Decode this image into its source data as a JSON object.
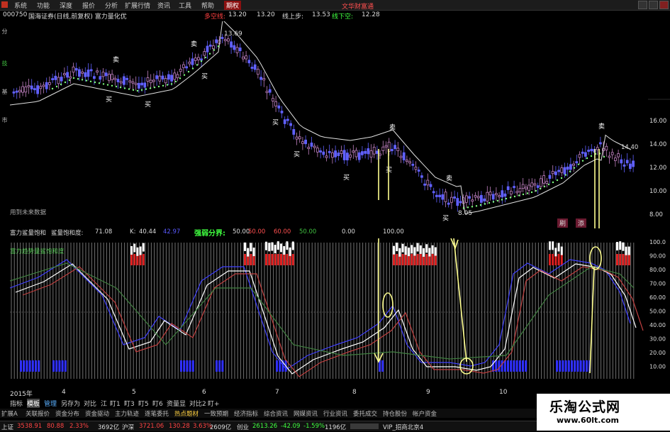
{
  "menu": {
    "items": [
      "系统",
      "功能",
      "深度",
      "报价",
      "分析",
      "扩展行情",
      "资讯",
      "工具",
      "帮助",
      "期权"
    ],
    "active_index": 9
  },
  "info_bar": {
    "code": "000750",
    "title": "国海证券(日线,前复权) 富力量化优",
    "duokong_label": "多空线:",
    "duokong_value": "13.20",
    "val2": "13.20",
    "xianshang_label": "线上步:",
    "xianshang_value": "13.53",
    "xianxia_label": "线下空:",
    "xianxia_value": "12.28",
    "top_right": "文华财富通"
  },
  "side_tabs": [
    "分时走势",
    "技术分析",
    "基本资料",
    "市场深度"
  ],
  "main_chart": {
    "price_axis": [
      "16.00",
      "14.00",
      "12.00",
      "10.00",
      "8.00"
    ],
    "annotations": {
      "high_label": "13.69",
      "low_label": "8.05",
      "right_label": "14.40",
      "future_note": "用到未来数据"
    },
    "signals": {
      "buy": "买",
      "sell": "卖"
    }
  },
  "indicator": {
    "name1": "富力鲨量饱和",
    "name2": "鲨量饱和度:",
    "value": "71.08",
    "k_label": "K:",
    "k_value": "40.44",
    "d_value": "42.97",
    "strength_label": "强弱分界:",
    "strength_value": "50.00",
    "v1": "50.00",
    "v2": "60.00",
    "v3": "50.00",
    "v4": "0.00",
    "v5": "100.00",
    "title_line": "富力趋势量鲨饱和度",
    "axis": [
      "100.0",
      "90.00",
      "80.00",
      "70.00",
      "60.00",
      "50.00",
      "40.00",
      "30.00",
      "20.00",
      "10.00"
    ],
    "pink_tab1": "刷",
    "pink_tab2": "添"
  },
  "time_axis": {
    "year": "2015年",
    "months": [
      "4",
      "5",
      "6",
      "7",
      "8",
      "9",
      "10"
    ]
  },
  "bottom_tabs": [
    "指标",
    "模板",
    "管理",
    "另存为",
    "对比",
    "江",
    "盯1",
    "盯3",
    "盯5",
    "盯6",
    "资量显",
    "对比2",
    "盯+"
  ],
  "function_bar": [
    "扩展A",
    "关联报价",
    "资金分布",
    "资金驱动",
    "主力轨迹",
    "逐笔委托",
    "热点题材",
    "一致预期",
    "经济指标",
    "综合资讯",
    "网媒资讯",
    "行业资讯",
    "委托成交",
    "持仓股份",
    "帐户资金"
  ],
  "status_bar": {
    "sh_label": "上证",
    "sh_value": "3538.91",
    "sh_change": "80.88",
    "sh_pct": "2.33%",
    "sh_amount": "3692亿",
    "hs_label": "沪深",
    "hs_value": "3721.06",
    "hs_change": "130.28",
    "hs_pct": "3.63%",
    "hs_amount": "2609亿",
    "cy_label": "创业",
    "cy_value": "2613.26",
    "cy_change": "-42.09",
    "cy_pct": "-1.59%",
    "cy_amount": "1196亿",
    "vip": "VIP_招商北京4"
  },
  "watermark": {
    "title": "乐淘公式网",
    "url": "www.60lt.com"
  },
  "colors": {
    "up": "#ff4444",
    "down": "#5a5aff",
    "accent_yellow": "#ffff80",
    "band": "#d0d0d0"
  }
}
